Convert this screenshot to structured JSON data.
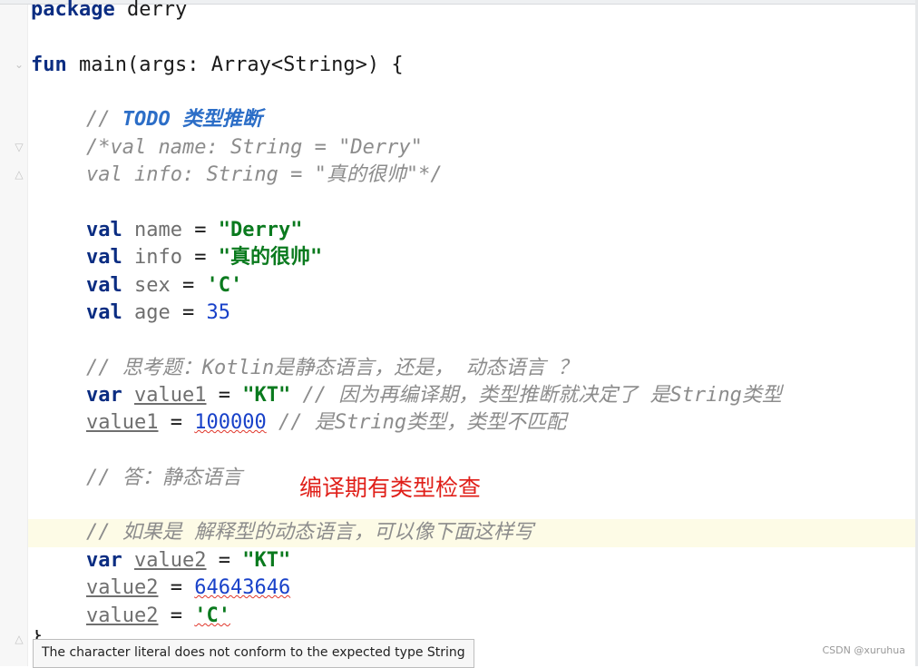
{
  "lines": {
    "package": {
      "kw": "package",
      "name": " derry"
    },
    "fun": {
      "kw": "fun",
      "rest": " main(args: Array<String>) {"
    },
    "todo": {
      "prefix": "// ",
      "todo": "TODO",
      "text": " 类型推断"
    },
    "cmt1": "/*val name: String = \"Derry\"",
    "cmt2": "val info: String = \"真的很帅\"*/",
    "val_name": {
      "kw": "val",
      "name": " name",
      "eq": " = ",
      "value": "\"Derry\""
    },
    "val_info": {
      "kw": "val",
      "name": " info",
      "eq": " = ",
      "value": "\"真的很帅\""
    },
    "val_sex": {
      "kw": "val",
      "name": " sex",
      "eq": " = ",
      "value": "'C'"
    },
    "val_age": {
      "kw": "val",
      "name": " age",
      "eq": " = ",
      "value": "35"
    },
    "cmt_think": "// 思考题：Kotlin是静态语言，还是， 动态语言 ？",
    "var_value1": {
      "kw": "var",
      "name": "value1",
      "eq": " = ",
      "value": "\"KT\"",
      "comment": " // 因为再编译期，类型推断就决定了 是String类型"
    },
    "assign_value1": {
      "name": "value1",
      "eq": " = ",
      "value": "100000",
      "comment": " // 是String类型，类型不匹配"
    },
    "cmt_answer": "// 答：静态语言",
    "cmt_dynamic_a": "// 如果是 解释型的动态语言",
    "cmt_dynamic_b": "，可以像下面这样写",
    "var_value2": {
      "kw": "var",
      "name": "value2",
      "eq": " = ",
      "value": "\"KT\""
    },
    "assign_value2a": {
      "name": "value2",
      "eq": " = ",
      "value": "64643646"
    },
    "assign_value2b": {
      "name": "value2",
      "eq": " = ",
      "value": "'C'"
    },
    "close_brace": "}"
  },
  "annotation": "编译期有类型检查",
  "tooltip": "The character literal does not conform to the expected type String",
  "watermark": "CSDN @xuruhua",
  "colors": {
    "keyword": "#0b2d82",
    "string": "#0a7a1e",
    "number": "#1841c9",
    "comment": "#8c8c8c",
    "todo": "#2c6ec7",
    "annotation": "#e0201a",
    "error_squiggle": "#e0362b"
  },
  "icons": {
    "fold_marker": "fold-icon"
  }
}
